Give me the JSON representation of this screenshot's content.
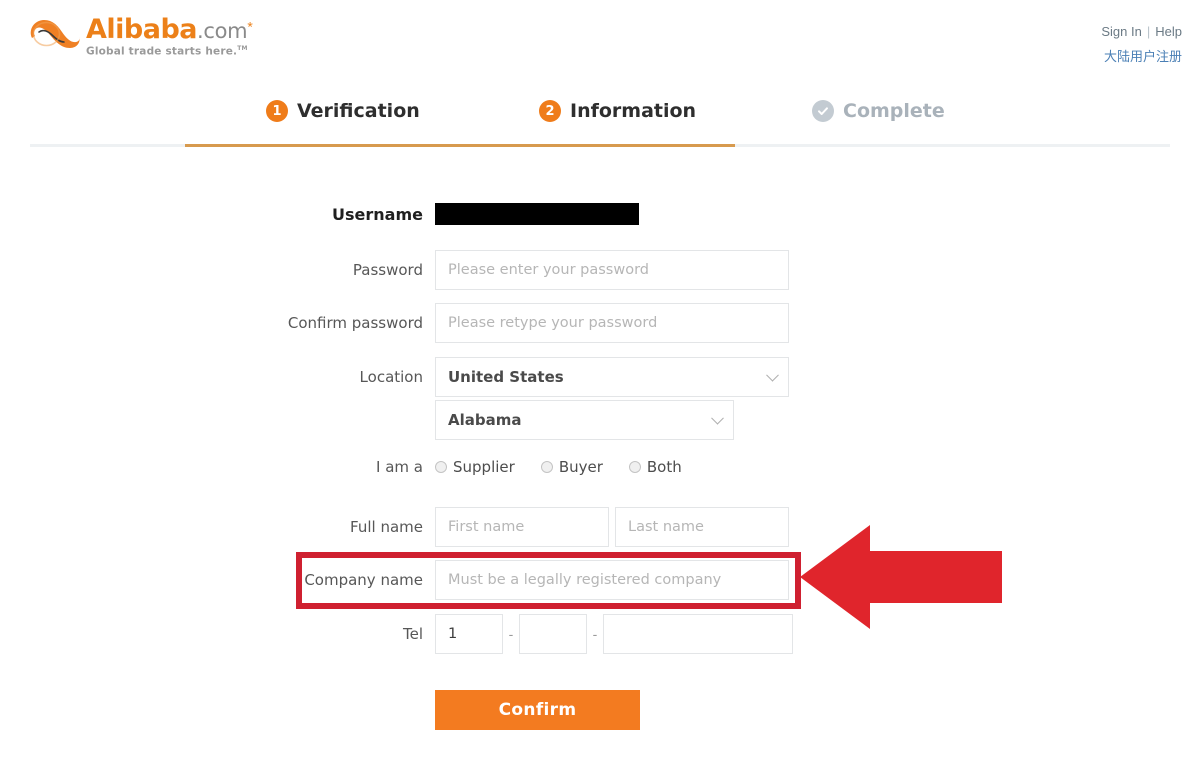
{
  "brand": {
    "name": "Alibaba",
    "domain": ".com",
    "star": "*",
    "tagline": "Global trade starts here.",
    "tm": "TM",
    "accent_color": "#ec8019",
    "button_color": "#f37b20",
    "annotation_color": "#cf2030"
  },
  "header": {
    "sign_in": "Sign In",
    "separator": "|",
    "help": "Help",
    "china_register": "大陆用户注册"
  },
  "steps": [
    {
      "badge": "1",
      "label": "Verification",
      "state": "active"
    },
    {
      "badge": "2",
      "label": "Information",
      "state": "active"
    },
    {
      "badge": "check-icon",
      "label": "Complete",
      "state": "pending"
    }
  ],
  "form": {
    "username": {
      "label": "Username",
      "value": "",
      "redacted": true
    },
    "password": {
      "label": "Password",
      "placeholder": "Please enter your password",
      "value": ""
    },
    "confirm_password": {
      "label": "Confirm password",
      "placeholder": "Please retype your password",
      "value": ""
    },
    "location": {
      "label": "Location",
      "country_value": "United States",
      "state_value": "Alabama"
    },
    "i_am_a": {
      "label": "I am a",
      "options": [
        {
          "label": "Supplier",
          "selected": false
        },
        {
          "label": "Buyer",
          "selected": false
        },
        {
          "label": "Both",
          "selected": false
        }
      ]
    },
    "full_name": {
      "label": "Full name",
      "first_placeholder": "First name",
      "last_placeholder": "Last name",
      "first_value": "",
      "last_value": ""
    },
    "company_name": {
      "label": "Company name",
      "placeholder": "Must be a legally registered company",
      "value": "",
      "highlighted": true
    },
    "tel": {
      "label": "Tel",
      "country_code": "1",
      "area_value": "",
      "number_value": "",
      "separator": "-"
    },
    "submit": {
      "label": "Confirm"
    }
  }
}
